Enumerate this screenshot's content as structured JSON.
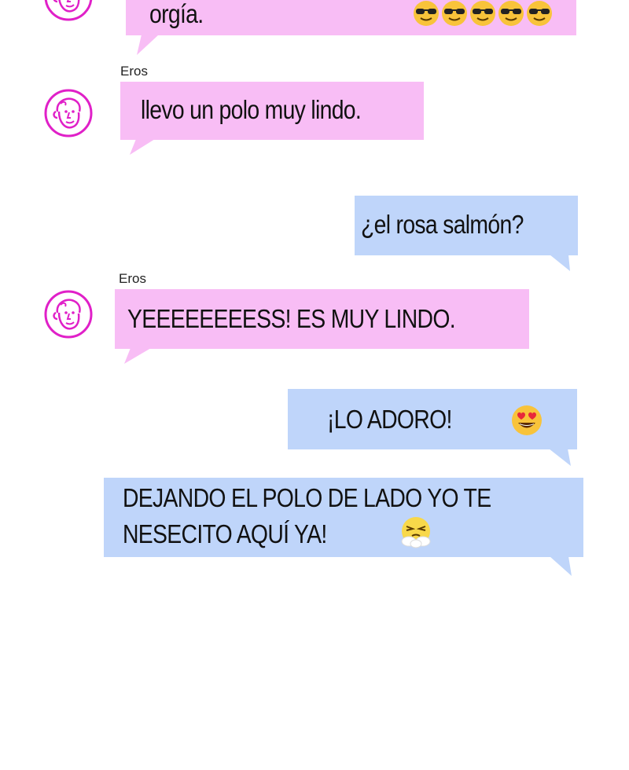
{
  "messages": [
    {
      "id": "m1",
      "side": "left",
      "text": "orgía.",
      "emoji_icons": [
        "sunglasses-face-icon",
        "sunglasses-face-icon",
        "sunglasses-face-icon",
        "sunglasses-face-icon",
        "sunglasses-face-icon"
      ]
    },
    {
      "id": "m2",
      "side": "left",
      "sender": "Eros",
      "text": "llevo un polo muy lindo."
    },
    {
      "id": "m3",
      "side": "right",
      "text": "¿el rosa salmón?"
    },
    {
      "id": "m4",
      "side": "left",
      "sender": "Eros",
      "text": "YEEEEEEEESS! ES MUY LINDO."
    },
    {
      "id": "m5",
      "side": "right",
      "text": "¡LO ADORO!",
      "emoji_icons": [
        "heart-eyes-face-icon"
      ]
    },
    {
      "id": "m6",
      "side": "right",
      "lines": [
        "DEJANDO EL POLO DE LADO YO TE",
        "NESECITO AQUÍ YA!"
      ],
      "emoji_icons": [
        "steam-nose-face-icon"
      ]
    }
  ],
  "colors": {
    "left_bubble": "#f8bdf5",
    "right_bubble": "#bfd5fa",
    "avatar_stroke": "#e020c8"
  }
}
